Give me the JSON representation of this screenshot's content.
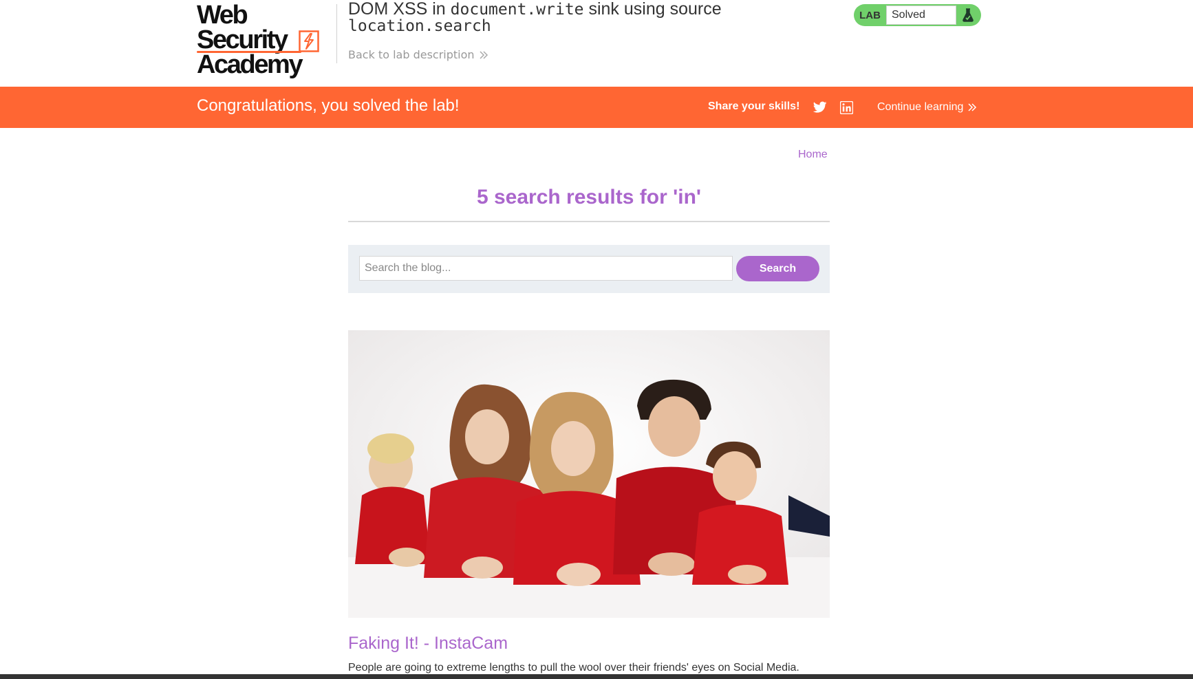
{
  "header": {
    "logo": {
      "line1": "Web Security",
      "line2": "Academy"
    },
    "lab_title_prefix": "DOM XSS in ",
    "lab_title_code1": "document.write",
    "lab_title_middle": " sink using source ",
    "lab_title_code2": "location.search",
    "back_link": "Back to lab description",
    "status": {
      "tag": "LAB",
      "value": "Solved"
    }
  },
  "banner": {
    "message": "Congratulations, you solved the lab!",
    "share_label": "Share your skills!",
    "continue_label": "Continue learning",
    "icons": [
      "twitter-icon",
      "linkedin-icon"
    ]
  },
  "nav": {
    "home": "Home"
  },
  "search": {
    "results_heading": "5 search results for 'in'",
    "placeholder": "Search the blog...",
    "button_label": "Search"
  },
  "posts": [
    {
      "title": "Faking It! - InstaCam",
      "excerpt": "People are going to extreme lengths to pull the wool over their friends' eyes on Social Media."
    }
  ],
  "colors": {
    "accent_orange": "#ff6633",
    "accent_purple": "#aa66cc",
    "status_green": "#70d06a",
    "search_panel": "#ebeff3"
  }
}
